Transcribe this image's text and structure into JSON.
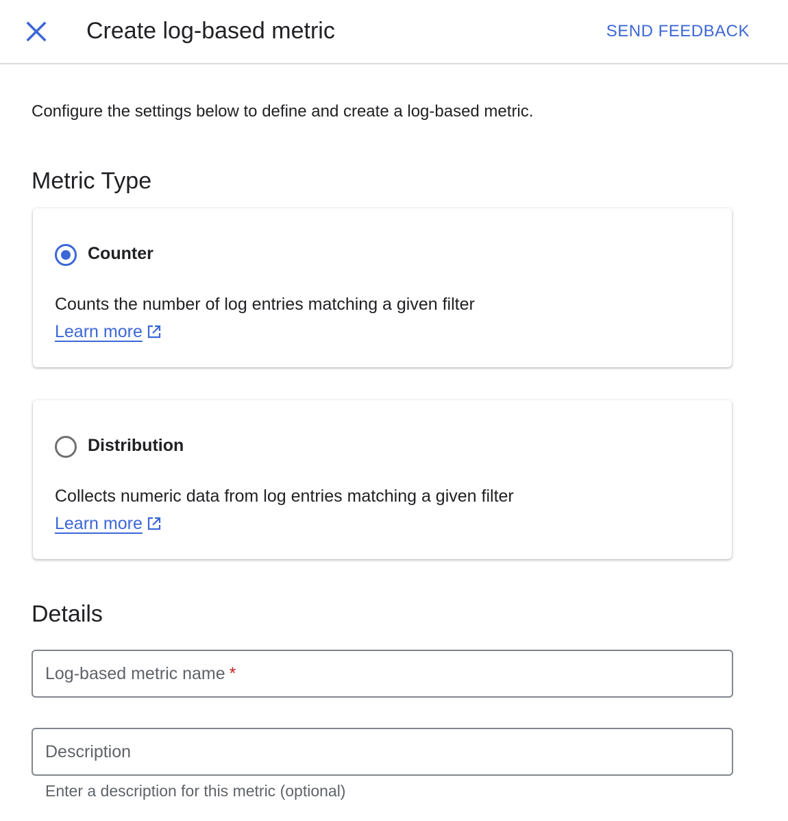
{
  "header": {
    "close_icon": "close-icon",
    "title": "Create log-based metric",
    "feedback_label": "SEND FEEDBACK"
  },
  "intro": "Configure the settings below to define and create a log-based metric.",
  "metric_type": {
    "heading": "Metric Type",
    "options": [
      {
        "label": "Counter",
        "selected": true,
        "description": "Counts the number of log entries matching a given filter",
        "link_label": "Learn more",
        "link_icon": "open-in-new-icon"
      },
      {
        "label": "Distribution",
        "selected": false,
        "description": "Collects numeric data from log entries matching a given filter",
        "link_label": "Learn more",
        "link_icon": "open-in-new-icon"
      }
    ]
  },
  "details": {
    "heading": "Details",
    "name_field": {
      "label": "Log-based metric name",
      "required_mark": "*",
      "value": ""
    },
    "description_field": {
      "label": "Description",
      "value": "",
      "hint": "Enter a description for this metric (optional)"
    }
  },
  "colors": {
    "accent": "#3c67d6",
    "required": "#c5221f",
    "text": "#202124",
    "muted": "#5f6368"
  }
}
